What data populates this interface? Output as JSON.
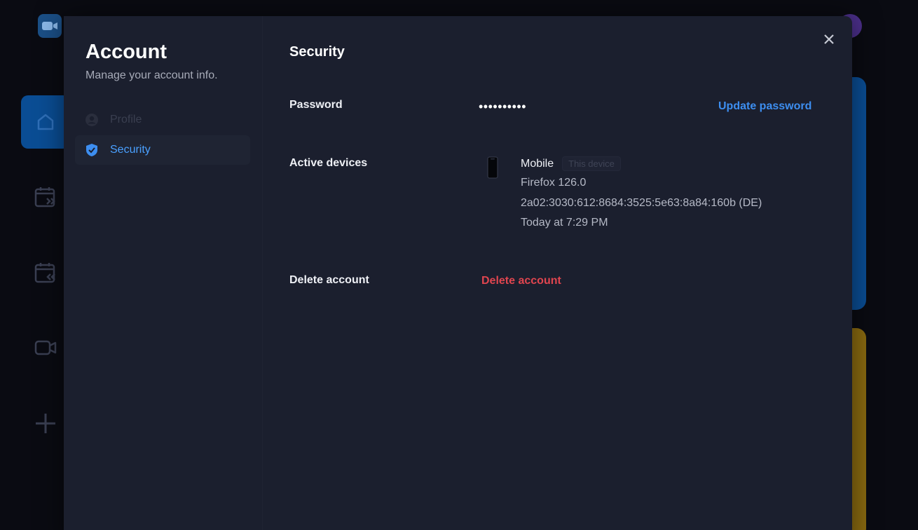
{
  "modal": {
    "title": "Account",
    "subtitle": "Manage your account info.",
    "nav": [
      {
        "label": "Profile",
        "icon": "user-circle-icon",
        "active": false
      },
      {
        "label": "Security",
        "icon": "shield-check-icon",
        "active": true
      }
    ],
    "close_icon": "close-icon"
  },
  "security": {
    "heading": "Security",
    "password": {
      "label": "Password",
      "masked_value": "••••••••••",
      "action": "Update password"
    },
    "devices": {
      "label": "Active devices",
      "items": [
        {
          "name": "Mobile",
          "badge": "This device",
          "browser": "Firefox 126.0",
          "ip": "2a02:3030:612:8684:3525:5e63:8a84:160b (DE)",
          "last_active": "Today at 7:29 PM",
          "icon": "mobile-phone-icon"
        }
      ]
    },
    "delete": {
      "label": "Delete account",
      "action": "Delete account"
    }
  },
  "colors": {
    "background": "#0a0b12",
    "modal": "#1b1f2e",
    "accent_blue": "#3d8ef0",
    "danger_red": "#e0454f",
    "app_accent": "#0a4d94"
  },
  "background_app": {
    "sidebar_icons": [
      "home-icon",
      "calendar-upcoming-icon",
      "calendar-past-icon",
      "video-camera-icon",
      "plus-icon"
    ]
  }
}
